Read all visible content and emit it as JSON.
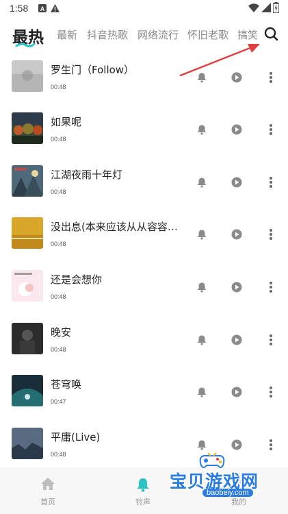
{
  "status_bar": {
    "time": "1:58"
  },
  "tabs": [
    {
      "label": "最热",
      "active": true
    },
    {
      "label": "最新",
      "active": false
    },
    {
      "label": "抖音热歌",
      "active": false
    },
    {
      "label": "网络流行",
      "active": false
    },
    {
      "label": "怀旧老歌",
      "active": false
    },
    {
      "label": "搞笑",
      "active": false
    }
  ],
  "songs": [
    {
      "title": "罗生门（Follow）",
      "duration": "00:48"
    },
    {
      "title": "如果呢",
      "duration": "00:48"
    },
    {
      "title": "江湖夜雨十年灯",
      "duration": "00:48"
    },
    {
      "title": "没出息(本来应该从从容容…",
      "duration": "00:48"
    },
    {
      "title": "还是会想你",
      "duration": "00:48"
    },
    {
      "title": "晚安",
      "duration": "00:48"
    },
    {
      "title": "苍穹唤",
      "duration": "00:47"
    },
    {
      "title": "平庸(Live)",
      "duration": "00:48"
    }
  ],
  "bottom_nav": [
    {
      "label": "首页",
      "icon": "home-icon",
      "active": false
    },
    {
      "label": "铃声",
      "icon": "bell-icon",
      "active": true
    },
    {
      "label": "我的",
      "icon": "user-icon",
      "active": false
    }
  ],
  "watermark": {
    "text": "宝贝游戏网",
    "url": "baobeiy.com"
  },
  "colors": {
    "accent": "#2bc4c4",
    "arrow": "#e04040",
    "icon_gray": "#8a8a8a"
  }
}
